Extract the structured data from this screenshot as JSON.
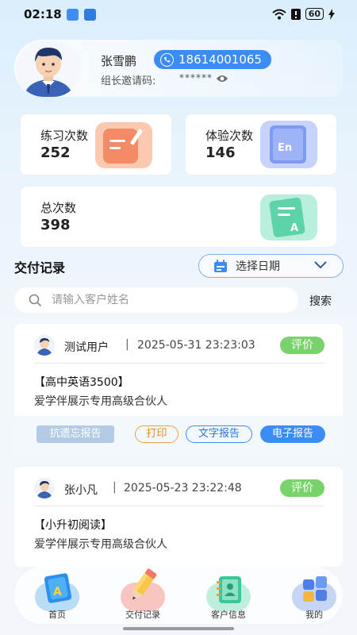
{
  "status_bar": {
    "time": "02:18",
    "battery": "60"
  },
  "profile": {
    "name": "张雪鹏",
    "phone": "18614001065",
    "invite_label": "组长邀请码:",
    "invite_code": "******"
  },
  "stats": [
    {
      "label": "练习次数",
      "value": "252"
    },
    {
      "label": "体验次数",
      "value": "146"
    },
    {
      "label": "总次数",
      "value": "398"
    }
  ],
  "delivery": {
    "title": "交付记录",
    "date_select_label": "选择日期",
    "search_placeholder": "请输入客户姓名",
    "search_button": "搜索"
  },
  "records": [
    {
      "name": "测试用户",
      "datetime": "2025-05-31 23:23:03",
      "rate_label": "评价",
      "course": "【高中英语3500】",
      "description": "爱学伴展示专用高级合伙人",
      "actions": [
        "抗遗忘报告",
        "打印",
        "文字报告",
        "电子报告"
      ]
    },
    {
      "name": "张小凡",
      "datetime": "2025-05-23 23:22:48",
      "rate_label": "评价",
      "course": "【小升初阅读】",
      "description": "爱学伴展示专用高级合伙人"
    }
  ],
  "nav": [
    {
      "label": "首页",
      "icon": "book-a-icon"
    },
    {
      "label": "交付记录",
      "icon": "pencil-icon"
    },
    {
      "label": "客户信息",
      "icon": "address-book-icon"
    },
    {
      "label": "我的",
      "icon": "tiles-icon"
    }
  ],
  "colors": {
    "accent": "#3c8cf6",
    "rate_green": "#78d46a",
    "print_orange": "#f0a23a"
  }
}
